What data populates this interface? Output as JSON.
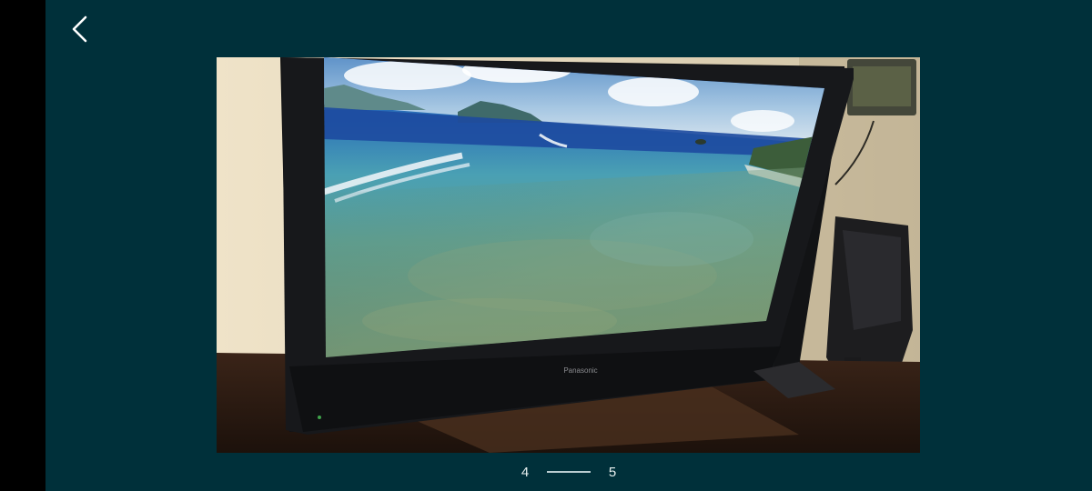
{
  "viewer": {
    "background_color": "#00303a",
    "back_icon": "chevron-left-icon"
  },
  "photo": {
    "subject": "",
    "tv_brand": "Panasonic"
  },
  "pager": {
    "current": "4",
    "total": "5"
  }
}
